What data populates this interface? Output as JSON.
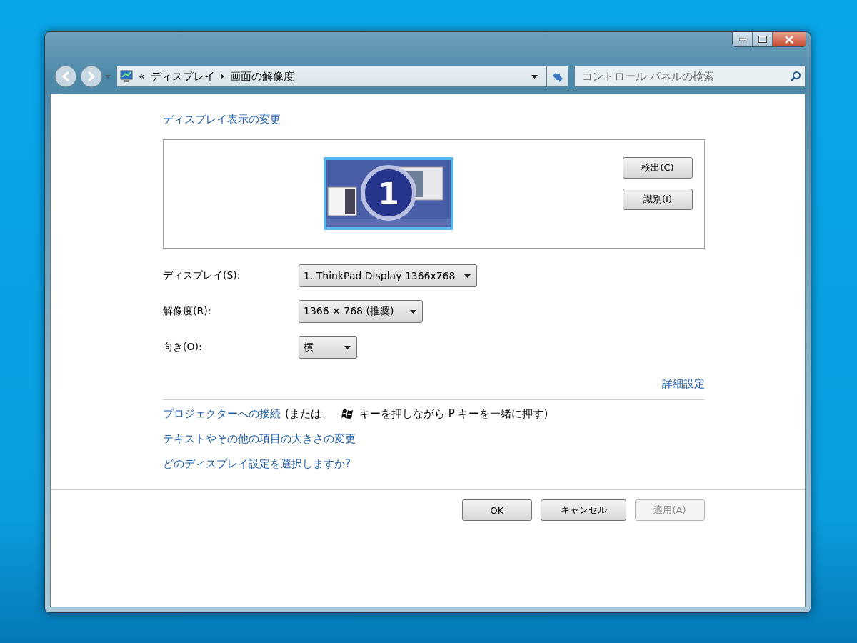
{
  "address_bar": {
    "overflow": "«",
    "breadcrumbs": [
      "ディスプレイ",
      "画面の解像度"
    ]
  },
  "search": {
    "placeholder": "コントロール パネルの検索"
  },
  "heading": "ディスプレイ表示の変更",
  "preview": {
    "monitor_number": "1",
    "buttons": [
      {
        "label": "検出(C)"
      },
      {
        "label": "識別(I)"
      }
    ]
  },
  "settings": [
    {
      "label": "ディスプレイ(S):",
      "value": "1. ThinkPad Display 1366x768"
    },
    {
      "label": "解像度(R):",
      "value": "1366 × 768 (推奨)"
    },
    {
      "label": "向き(O):",
      "value": "横"
    }
  ],
  "advanced_link": "詳細設定",
  "projector_line": {
    "link": "プロジェクターへの接続",
    "before_key": "(または、",
    "after_key": "キーを押しながら P キーを一緒に押す)"
  },
  "links": [
    "テキストやその他の項目の大きさの変更",
    "どのディスプレイ設定を選択しますか?"
  ],
  "buttons": [
    {
      "label": "OK",
      "disabled": false
    },
    {
      "label": "キャンセル",
      "disabled": false
    },
    {
      "label": "適用(A)",
      "disabled": true
    }
  ]
}
